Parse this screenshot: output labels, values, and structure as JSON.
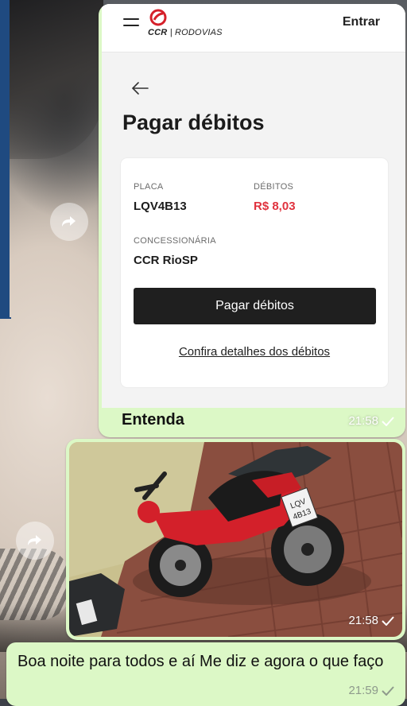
{
  "bubble1": {
    "app": {
      "brand_name": "CCR",
      "brand_division": "RODOVIAS",
      "enter_label": "Entrar",
      "page_title": "Pagar débitos",
      "card": {
        "plate_label": "PLACA",
        "plate_value": "LQV4B13",
        "debts_label": "DÉBITOS",
        "debts_value": "R$ 8,03",
        "concession_label": "CONCESSIONÁRIA",
        "concession_value": "CCR RioSP",
        "pay_button": "Pagar débitos",
        "details_link": "Confira detalhes dos débitos"
      }
    },
    "caption": "Entenda",
    "time": "21:58"
  },
  "bubble2": {
    "time": "21:58",
    "photo_plate_text": "LQV\n4B13",
    "photo_plate_small": "LQV 4B13"
  },
  "bubble3": {
    "text": "Boa noite para todos e aí Me diz e agora o que faço",
    "time": "21:59"
  },
  "colors": {
    "bubble": "#dcf8c6",
    "debt_red": "#e0323e",
    "button_dark": "#1f1f1f",
    "brand_red": "#d5202a"
  },
  "icons": [
    "forward-icon",
    "menu-icon",
    "ccr-logo-icon",
    "back-arrow-icon",
    "read-check-icon"
  ]
}
